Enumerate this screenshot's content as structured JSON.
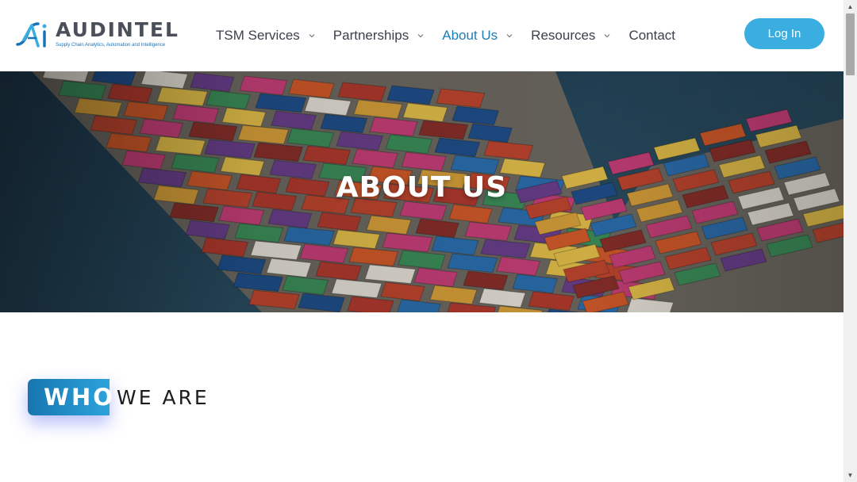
{
  "logo": {
    "word": "AUDINTEL",
    "mark": "Ai",
    "tagline": "Supply Chain Analytics, Automation and Intelligence"
  },
  "nav": {
    "items": [
      {
        "label": "TSM Services",
        "dropdown": true
      },
      {
        "label": "Partnerships",
        "dropdown": true
      },
      {
        "label": "About Us",
        "dropdown": true,
        "active": true
      },
      {
        "label": "Resources",
        "dropdown": true
      },
      {
        "label": "Contact",
        "dropdown": false
      }
    ],
    "login_label": "Log In"
  },
  "hero": {
    "title": "ABOUT US",
    "image": "container-ship-aerial"
  },
  "section": {
    "highlight": "WHO",
    "rest": "WE ARE"
  },
  "colors": {
    "accent": "#1b7fb5",
    "button": "#3aaee0",
    "text": "#3a3f4a"
  }
}
